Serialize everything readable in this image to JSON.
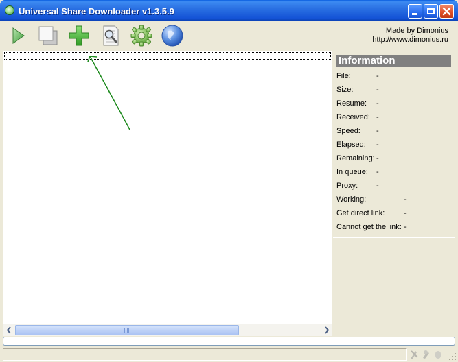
{
  "window": {
    "title": "Universal Share Downloader v1.3.5.9"
  },
  "toolbar": {
    "buttons": [
      {
        "name": "start",
        "icon": "play-icon"
      },
      {
        "name": "copy",
        "icon": "copy-icon"
      },
      {
        "name": "add",
        "icon": "plus-icon"
      },
      {
        "name": "find",
        "icon": "document-search-icon"
      },
      {
        "name": "settings",
        "icon": "gear-icon"
      },
      {
        "name": "website",
        "icon": "globe-icon"
      }
    ],
    "credit_line1": "Made by Dimonius",
    "credit_line2": "http://www.dimonius.ru"
  },
  "info": {
    "header": "Information",
    "rows": [
      {
        "label": "File:",
        "value": "-"
      },
      {
        "label": "Size:",
        "value": "-"
      },
      {
        "label": "Resume:",
        "value": "-"
      },
      {
        "label": "Received:",
        "value": "-"
      },
      {
        "label": "Speed:",
        "value": "-"
      },
      {
        "label": "Elapsed:",
        "value": "-"
      },
      {
        "label": "Remaining:",
        "value": "-"
      },
      {
        "label": "In queue:",
        "value": "-"
      },
      {
        "label": "Proxy:",
        "value": "-"
      },
      {
        "label": "Working:",
        "value": "-"
      },
      {
        "label": "Get direct link:",
        "value": "-"
      },
      {
        "label": "Cannot get the link:",
        "value": "-"
      }
    ]
  },
  "progress": {
    "fraction": 0
  },
  "colors": {
    "accent_green": "#1e8a1e",
    "info_header_bg": "#808080",
    "window_bg": "#ece9d8",
    "titlebar_blue": "#2b71e3"
  }
}
